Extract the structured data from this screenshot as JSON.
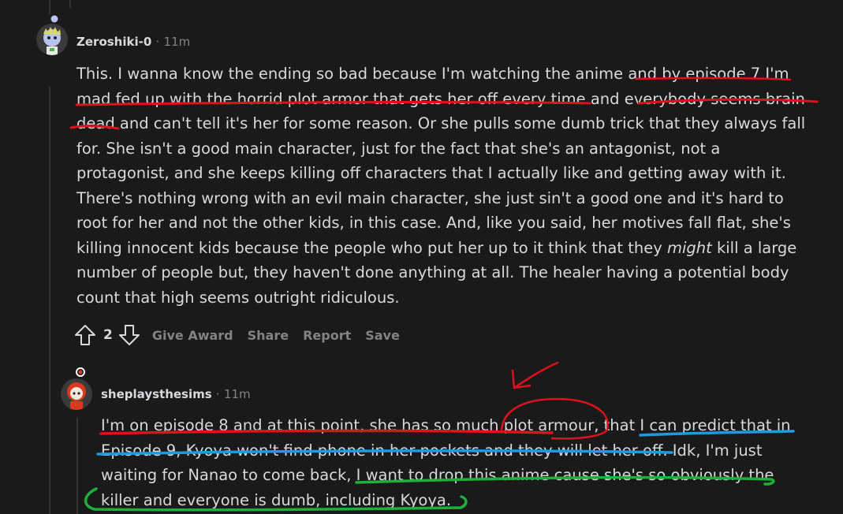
{
  "comment1": {
    "username": "Zeroshiki-0",
    "separator": "·",
    "age": "11m",
    "lines": [
      "This. I wanna know the ending so bad because I'm watching the anime and by episode 7 I'm",
      "mad fed up with the horrid plot armor that gets her off every time and everybody seems brain",
      "dead and can't tell it's her for some reason. Or she pulls some dumb trick that they always fall",
      "for. She isn't a good main character, just for the fact that she's an antagonist, not a",
      "protagonist, and she keeps killing off characters that I actually like and getting away with it.",
      "There's nothing wrong with an evil main character, she just sin't a good one and it's hard to",
      "root for her and not the other kids, in this case. And, like you said, her motives fall flat, she's"
    ],
    "line8_before": "killing innocent kids because the people who put her up to it think that they ",
    "line8_italic": "might",
    "line8_after": " kill a large",
    "lines_end": [
      "number of people but, they haven't done anything at all. The healer having a potential body",
      "count that high seems outright ridiculous."
    ],
    "votes": "2",
    "actions": {
      "award": "Give Award",
      "share": "Share",
      "report": "Report",
      "save": "Save"
    }
  },
  "comment2": {
    "username": "sheplaysthesims",
    "separator": "·",
    "age": "11m",
    "lines": [
      "I'm on episode 8 and at this point, she has so much plot armour, that I can predict that in",
      "Episode 9, Kyoya won't find phone in her pockets and they will let her off. Idk, I'm just",
      "waiting for Nanao to come back, I want to drop this anime cause she's so obviously the",
      "killer and everyone is dumb, including Kyoya."
    ]
  },
  "colors": {
    "background": "#1a1a1b",
    "text": "#d7dadc",
    "meta": "#818384",
    "annotation_red": "#e0101c",
    "annotation_blue": "#1e9be0",
    "annotation_green": "#1fb03a"
  }
}
